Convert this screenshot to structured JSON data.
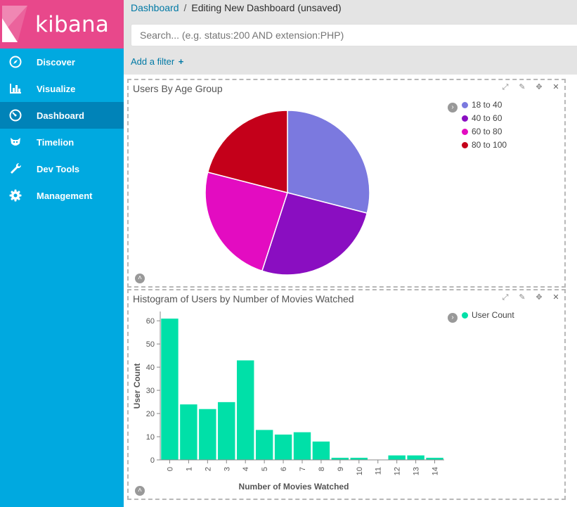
{
  "brand": {
    "name": "kibana"
  },
  "sidebar": {
    "items": [
      {
        "label": "Discover",
        "icon": "compass-icon"
      },
      {
        "label": "Visualize",
        "icon": "bar-chart-icon"
      },
      {
        "label": "Dashboard",
        "icon": "gauge-icon",
        "active": true
      },
      {
        "label": "Timelion",
        "icon": "timelion-icon"
      },
      {
        "label": "Dev Tools",
        "icon": "wrench-icon"
      },
      {
        "label": "Management",
        "icon": "gear-icon"
      }
    ]
  },
  "breadcrumb": {
    "link": "Dashboard",
    "separator": "/",
    "current": "Editing New Dashboard (unsaved)"
  },
  "search": {
    "placeholder": "Search... (e.g. status:200 AND extension:PHP)"
  },
  "filter": {
    "add_label": "Add a filter",
    "plus": "+"
  },
  "colors": {
    "sidebar": "#00a9e0",
    "brand": "#e8488b",
    "active_nav": "#0083b8",
    "link": "#0079a5"
  },
  "panels": {
    "pie": {
      "title": "Users By Age Group"
    },
    "hist": {
      "title": "Histogram of Users by Number of Movies Watched"
    }
  },
  "chart_data": [
    {
      "type": "pie",
      "title": "Users By Age Group",
      "categories": [
        "18 to 40",
        "40 to 60",
        "60 to 80",
        "80 to 100"
      ],
      "values": [
        29,
        26,
        24,
        21
      ],
      "colors": [
        "#7b79df",
        "#8a0ec1",
        "#e30cc1",
        "#c4001a"
      ],
      "legend_position": "top-right"
    },
    {
      "type": "bar",
      "title": "Histogram of Users by Number of Movies Watched",
      "xlabel": "Number of Movies Watched",
      "ylabel": "User Count",
      "categories": [
        "0",
        "1",
        "2",
        "3",
        "4",
        "5",
        "6",
        "7",
        "8",
        "9",
        "10",
        "11",
        "12",
        "13",
        "14"
      ],
      "series": [
        {
          "name": "User Count",
          "values": [
            61,
            24,
            22,
            25,
            43,
            13,
            11,
            12,
            8,
            1,
            1,
            0,
            2,
            2,
            1
          ],
          "color": "#00e0a8"
        }
      ],
      "yticks": [
        0,
        10,
        20,
        30,
        40,
        50,
        60
      ],
      "ylim": [
        0,
        64
      ],
      "legend_position": "top-right"
    }
  ]
}
